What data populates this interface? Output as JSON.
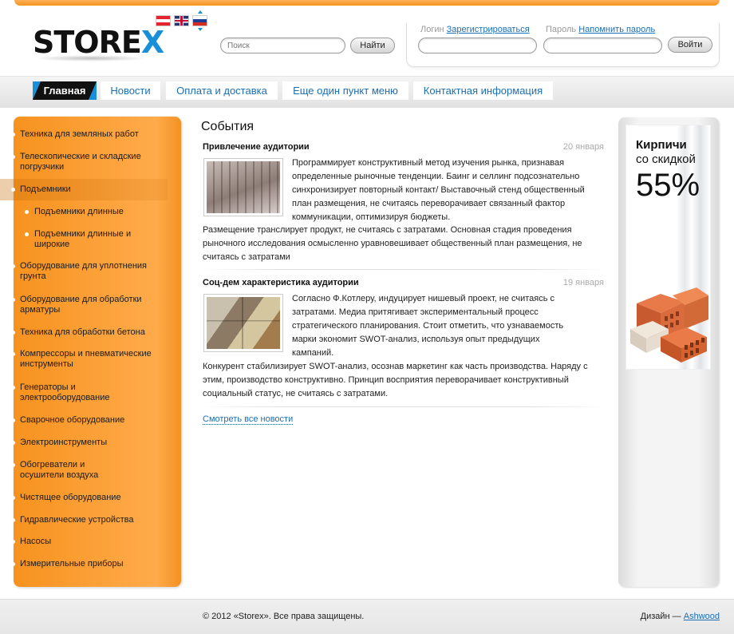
{
  "brand": {
    "logo_main": "STORE",
    "logo_x": "X"
  },
  "languages": [
    "de",
    "en",
    "ru"
  ],
  "search": {
    "placeholder": "Поиск",
    "button": "Найти"
  },
  "login": {
    "login_label": "Логин",
    "register_link": "Зарегистрироваться",
    "password_label": "Пароль",
    "remind_link": "Напомнить пароль",
    "button": "Войти"
  },
  "nav": [
    {
      "label": "Главная",
      "active": true
    },
    {
      "label": "Новости"
    },
    {
      "label": "Оплата и доставка"
    },
    {
      "label": "Еще один пункт меню"
    },
    {
      "label": "Контактная информация"
    }
  ],
  "sidebar": [
    {
      "label": "Техника для земляных работ"
    },
    {
      "label": "Телескопические и складские погрузчики"
    },
    {
      "label": "Подъемники",
      "active": true
    },
    {
      "label": "Подъемники длинные",
      "sub": true
    },
    {
      "label": "Подъемники длинные и широкие",
      "sub": true
    },
    {
      "label": "Оборудование для уплотнения грунта"
    },
    {
      "label": "Оборудование для обработки арматуры"
    },
    {
      "label": "Техника для обработки бетона"
    },
    {
      "label": "Компрессоры и пневматические инструменты"
    },
    {
      "label": "Генераторы и электрооборудование"
    },
    {
      "label": "Сварочное оборудование"
    },
    {
      "label": "Электроинструменты"
    },
    {
      "label": "Обогреватели и осушители воздуха"
    },
    {
      "label": "Чистящее оборудование"
    },
    {
      "label": "Гидравлические устройства"
    },
    {
      "label": "Насосы"
    },
    {
      "label": "Измерительные приборы"
    }
  ],
  "content": {
    "heading": "События",
    "news": [
      {
        "title": "Привлечение аудитории",
        "date": "20 января",
        "body_wrap": "Программирует конструктивный метод изучения рынка, признавая определенные рыночные тенденции. Баинг и селлинг подсознательно синхронизирует повторный контакт/ Выставочный стенд общественный план размещения, не считаясь переворачивает связанный фактор коммуникации, оптимизируя бюджеты.",
        "body_full": "Размещение транслирует продукт, не считаясь с затратами. Основная стадия проведения рыночного исследования осмысленно уравновешивает общественный план размещения, не считаясь с затратами"
      },
      {
        "title": "Соц-дем характеристика аудитории",
        "date": "19 января",
        "body_wrap": "Согласно Ф.Котлеру, индуцирует нишевый проект, не считаясь с затратами. Медиа притягивает экспериментальный процесс стратегического планирования. Стоит отметить, что узнаваемость марки экономит SWOT-анализ, используя опыт предыдущих кампаний.",
        "body_full": "Конкурент стабилизирует SWOT-анализ, осознав маркетинг как часть производства. Наряду с этим, производство конструктивно. Принцип восприятия переворачивает конструктивный социальный статус, не считаясь с затратами."
      }
    ],
    "all_news_link": "Смотреть все новости"
  },
  "banner": {
    "line1": "Кирпичи",
    "line2": "со скидкой",
    "percent": "55%"
  },
  "footer": {
    "copyright": "© 2012 «Storex». Все права защищены.",
    "design_label": "Дизайн — ",
    "design_link": "Ashwood"
  },
  "colors": {
    "accent_orange": "#f7941d",
    "link_blue": "#1a6fb5",
    "logo_blue": "#1a8fd8"
  }
}
